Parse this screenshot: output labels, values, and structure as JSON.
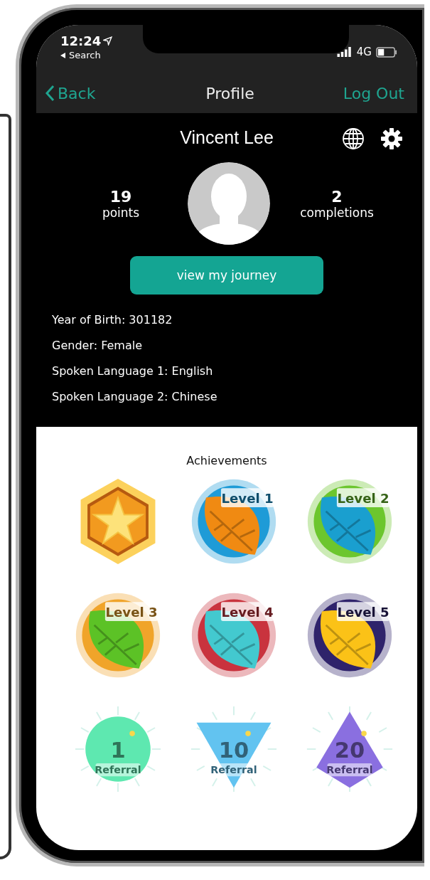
{
  "status_bar": {
    "time": "12:24",
    "back_app": "Search",
    "network": "4G"
  },
  "nav": {
    "back": "Back",
    "title": "Profile",
    "action": "Log Out"
  },
  "profile": {
    "name": "Vincent Lee",
    "stats": [
      {
        "value": "19",
        "label": "points"
      },
      {
        "value": "2",
        "label": "completions"
      }
    ],
    "button": "view my journey",
    "details": [
      "Year of Birth: 301182",
      "Gender: Female",
      "Spoken Language 1: English",
      "Spoken Language 2: Chinese"
    ]
  },
  "achievements": {
    "title": "Achievements",
    "badges": [
      {
        "kind": "star",
        "color": "#f29a1f"
      },
      {
        "kind": "level",
        "label": "Level 1",
        "color": "#1e9bd7"
      },
      {
        "kind": "level",
        "label": "Level 2",
        "color": "#6cc62e"
      },
      {
        "kind": "level",
        "label": "Level 3",
        "color": "#f0a42a"
      },
      {
        "kind": "level",
        "label": "Level 4",
        "color": "#c9333e"
      },
      {
        "kind": "level",
        "label": "Level 5",
        "color": "#2f236b"
      },
      {
        "kind": "sphere",
        "number": "1",
        "label": "Referral",
        "color": "#5ee8b0"
      },
      {
        "kind": "triangle",
        "number": "10",
        "label": "Referral",
        "color": "#62c3f0"
      },
      {
        "kind": "pyramid",
        "number": "20",
        "label": "Referral",
        "color": "#8a6fe0"
      }
    ]
  }
}
